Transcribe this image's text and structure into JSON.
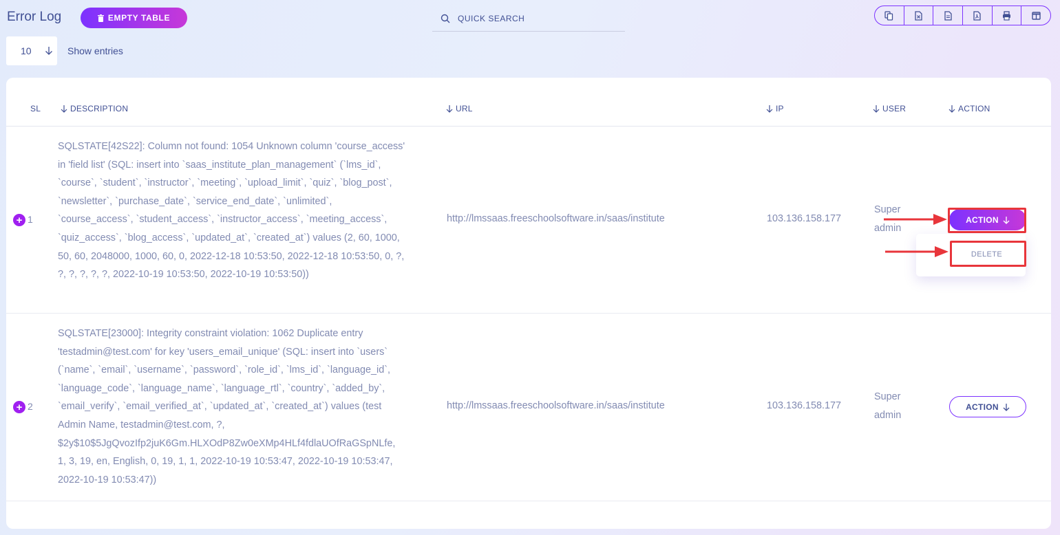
{
  "header": {
    "title": "Error Log",
    "empty_table_label": "EMPTY TABLE",
    "search_placeholder": "QUICK SEARCH",
    "export_icons": [
      "copy-icon",
      "excel-icon",
      "csv-icon",
      "pdf-icon",
      "print-icon",
      "columns-icon"
    ]
  },
  "entries": {
    "value": "10",
    "label": "Show entries"
  },
  "table": {
    "columns": [
      "SL",
      "DESCRIPTION",
      "URL",
      "IP",
      "USER",
      "ACTION"
    ],
    "rows": [
      {
        "sl": "1",
        "description": "SQLSTATE[42S22]: Column not found: 1054 Unknown column 'course_access' in 'field list' (SQL: insert into `saas_institute_plan_management` (`lms_id`, `course`, `student`, `instructor`, `meeting`, `upload_limit`, `quiz`, `blog_post`, `newsletter`, `purchase_date`, `service_end_date`, `unlimited`, `course_access`, `student_access`, `instructor_access`, `meeting_access`, `quiz_access`, `blog_access`, `updated_at`, `created_at`) values (2, 60, 1000, 50, 60, 2048000, 1000, 60, 0, 2022-12-18 10:53:50, 2022-12-18 10:53:50, 0, ?, ?, ?, ?, ?, ?, 2022-10-19 10:53:50, 2022-10-19 10:53:50))",
        "url": "http://lmssaas.freeschoolsoftware.in/saas/institute",
        "ip": "103.136.158.177",
        "user": "Super admin",
        "action_label": "ACTION"
      },
      {
        "sl": "2",
        "description": "SQLSTATE[23000]: Integrity constraint violation: 1062 Duplicate entry 'testadmin@test.com' for key 'users_email_unique' (SQL: insert into `users` (`name`, `email`, `username`, `password`, `role_id`, `lms_id`, `language_id`, `language_code`, `language_name`, `language_rtl`, `country`, `added_by`, `email_verify`, `email_verified_at`, `updated_at`, `created_at`) values (test Admin Name, testadmin@test.com, ?, $2y$10$5JgQvozIfp2juK6Gm.HLXOdP8Zw0eXMp4HLf4fdlaUOfRaGSpNLfe, 1, 3, 19, en, English, 0, 19, 1, 1, 2022-10-19 10:53:47, 2022-10-19 10:53:47, 2022-10-19 10:53:47))",
        "url": "http://lmssaas.freeschoolsoftware.in/saas/institute",
        "ip": "103.136.158.177",
        "user": "Super admin",
        "action_label": "ACTION"
      }
    ]
  },
  "dropdown": {
    "delete_label": "DELETE"
  },
  "colors": {
    "accent_start": "#7c32ff",
    "accent_end": "#c738d8",
    "annotation_red": "#e8353b",
    "text_primary": "#415094",
    "text_muted": "#828bb2"
  }
}
